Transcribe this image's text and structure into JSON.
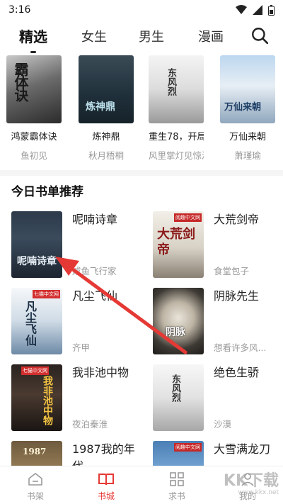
{
  "status": {
    "time": "3:16"
  },
  "tabs": [
    {
      "label": "精选",
      "active": true
    },
    {
      "label": "女生",
      "active": false
    },
    {
      "label": "男生",
      "active": false
    },
    {
      "label": "漫画",
      "active": false
    }
  ],
  "top_books": [
    {
      "title": "鸿蒙霸体诀",
      "author": "鱼初见",
      "cover_text": "霸体诀"
    },
    {
      "title": "炼神鼎",
      "author": "秋月梧桐",
      "cover_text": "炼神鼎"
    },
    {
      "title": "重生78，开局...",
      "author": "风里掌灯见惊泓",
      "cover_text": "东风烈"
    },
    {
      "title": "万仙来朝",
      "author": "萧瑾瑜",
      "cover_text": "万仙来朝"
    }
  ],
  "section": {
    "title": "今日书单推荐"
  },
  "grid_books": [
    {
      "title": "呢喃诗章",
      "author": "咸鱼飞行家",
      "cover_text": "呢喃诗章",
      "badge": ""
    },
    {
      "title": "大荒剑帝",
      "author": "食堂包子",
      "cover_text": "大荒剑帝",
      "badge": "阅趣中文网"
    },
    {
      "title": "凡尘飞仙",
      "author": "齐甲",
      "cover_text": "凡尘飞仙",
      "badge": "七猫中文网"
    },
    {
      "title": "阴脉先生",
      "author": "想看许多风...",
      "cover_text": "阴脉",
      "badge": ""
    },
    {
      "title": "我非池中物",
      "author": "夜泊秦淮",
      "cover_text": "我非池中物",
      "badge": "七猫中文网"
    },
    {
      "title": "绝色生骄",
      "author": "沙漠",
      "cover_text": "东风烈",
      "badge": ""
    },
    {
      "title": "1987我的年代",
      "author": "",
      "cover_text": "1987",
      "badge": ""
    },
    {
      "title": "大雪满龙刀",
      "author": "",
      "cover_text": "",
      "badge": "阅趣中文网"
    }
  ],
  "bottom_nav": [
    {
      "label": "书架",
      "icon": "shelf-icon",
      "active": false
    },
    {
      "label": "书城",
      "icon": "book-icon",
      "active": true
    },
    {
      "label": "求书",
      "icon": "grid-icon",
      "active": false
    },
    {
      "label": "我的",
      "icon": "user-icon",
      "active": false
    }
  ],
  "watermark": {
    "text": "KK下载",
    "sub": "www.kkx.net"
  },
  "colors": {
    "accent": "#e53935",
    "annotation_arrow": "#e53935"
  }
}
